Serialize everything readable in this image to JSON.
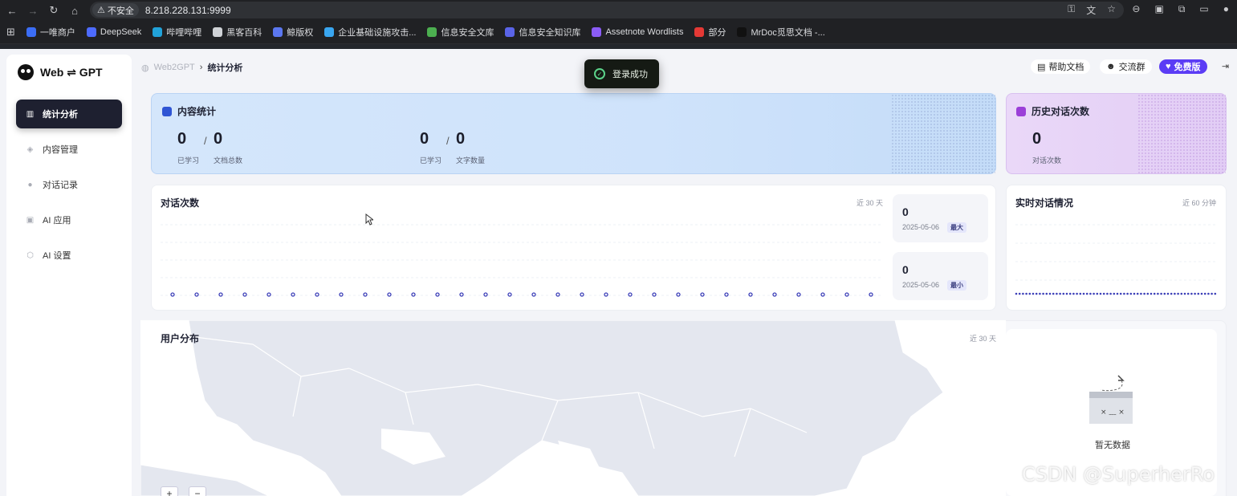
{
  "browser": {
    "security_label": "不安全",
    "url": "8.218.228.131:9999",
    "bookmarks": [
      {
        "label": "一唯商户",
        "color": "#3b6df5"
      },
      {
        "label": "DeepSeek",
        "color": "#4d6bfe"
      },
      {
        "label": "哔哩哔哩",
        "color": "#21a2d9"
      },
      {
        "label": "黑客百科",
        "color": "#cfd2d6"
      },
      {
        "label": "鲸版权",
        "color": "#5b77f0"
      },
      {
        "label": "企业基础设施攻击...",
        "color": "#39a6f0"
      },
      {
        "label": "信息安全文库",
        "color": "#4caf50"
      },
      {
        "label": "信息安全知识库",
        "color": "#5a64e8"
      },
      {
        "label": "Assetnote Wordlists",
        "color": "#8b5cf6"
      },
      {
        "label": "部分",
        "color": "#e53935"
      },
      {
        "label": "MrDoc觅思文档 -...",
        "color": "#111111"
      }
    ]
  },
  "app": {
    "logo_text": "Web ⇌ GPT",
    "menu": [
      {
        "label": "统计分析",
        "icon": "bar-chart-icon",
        "active": true
      },
      {
        "label": "内容管理",
        "icon": "layers-icon",
        "active": false
      },
      {
        "label": "对话记录",
        "icon": "chat-icon",
        "active": false
      },
      {
        "label": "AI 应用",
        "icon": "app-icon",
        "active": false
      },
      {
        "label": "AI 设置",
        "icon": "cube-icon",
        "active": false
      }
    ],
    "breadcrumb": {
      "root": "Web2GPT",
      "current": "统计分析"
    },
    "toast": "登录成功",
    "header_buttons": {
      "docs": "帮助文档",
      "group": "交流群",
      "free": "免费版"
    }
  },
  "content_stats": {
    "title": "内容统计",
    "learned": "0",
    "learned_label": "已学习",
    "docs_total": "0",
    "docs_total_label": "文档总数",
    "learned2": "0",
    "learned2_label": "已学习",
    "chars_total": "0",
    "chars_total_label": "文字数量"
  },
  "history": {
    "title": "历史对话次数",
    "count": "0",
    "count_label": "对话次数"
  },
  "dialog_chart": {
    "title": "对话次数",
    "range": "近 30 天",
    "max": {
      "value": "0",
      "date": "2025-05-06",
      "tag": "最大"
    },
    "min": {
      "value": "0",
      "date": "2025-05-06",
      "tag": "最小"
    },
    "point_count": 30
  },
  "realtime": {
    "title": "实时对话情况",
    "range": "近 60 分钟"
  },
  "user_dist": {
    "title": "用户分布",
    "range": "近 30 天",
    "empty": "暂无数据",
    "zoom_in": "+",
    "zoom_out": "−"
  },
  "watermark": "CSDN @SuperherRo"
}
